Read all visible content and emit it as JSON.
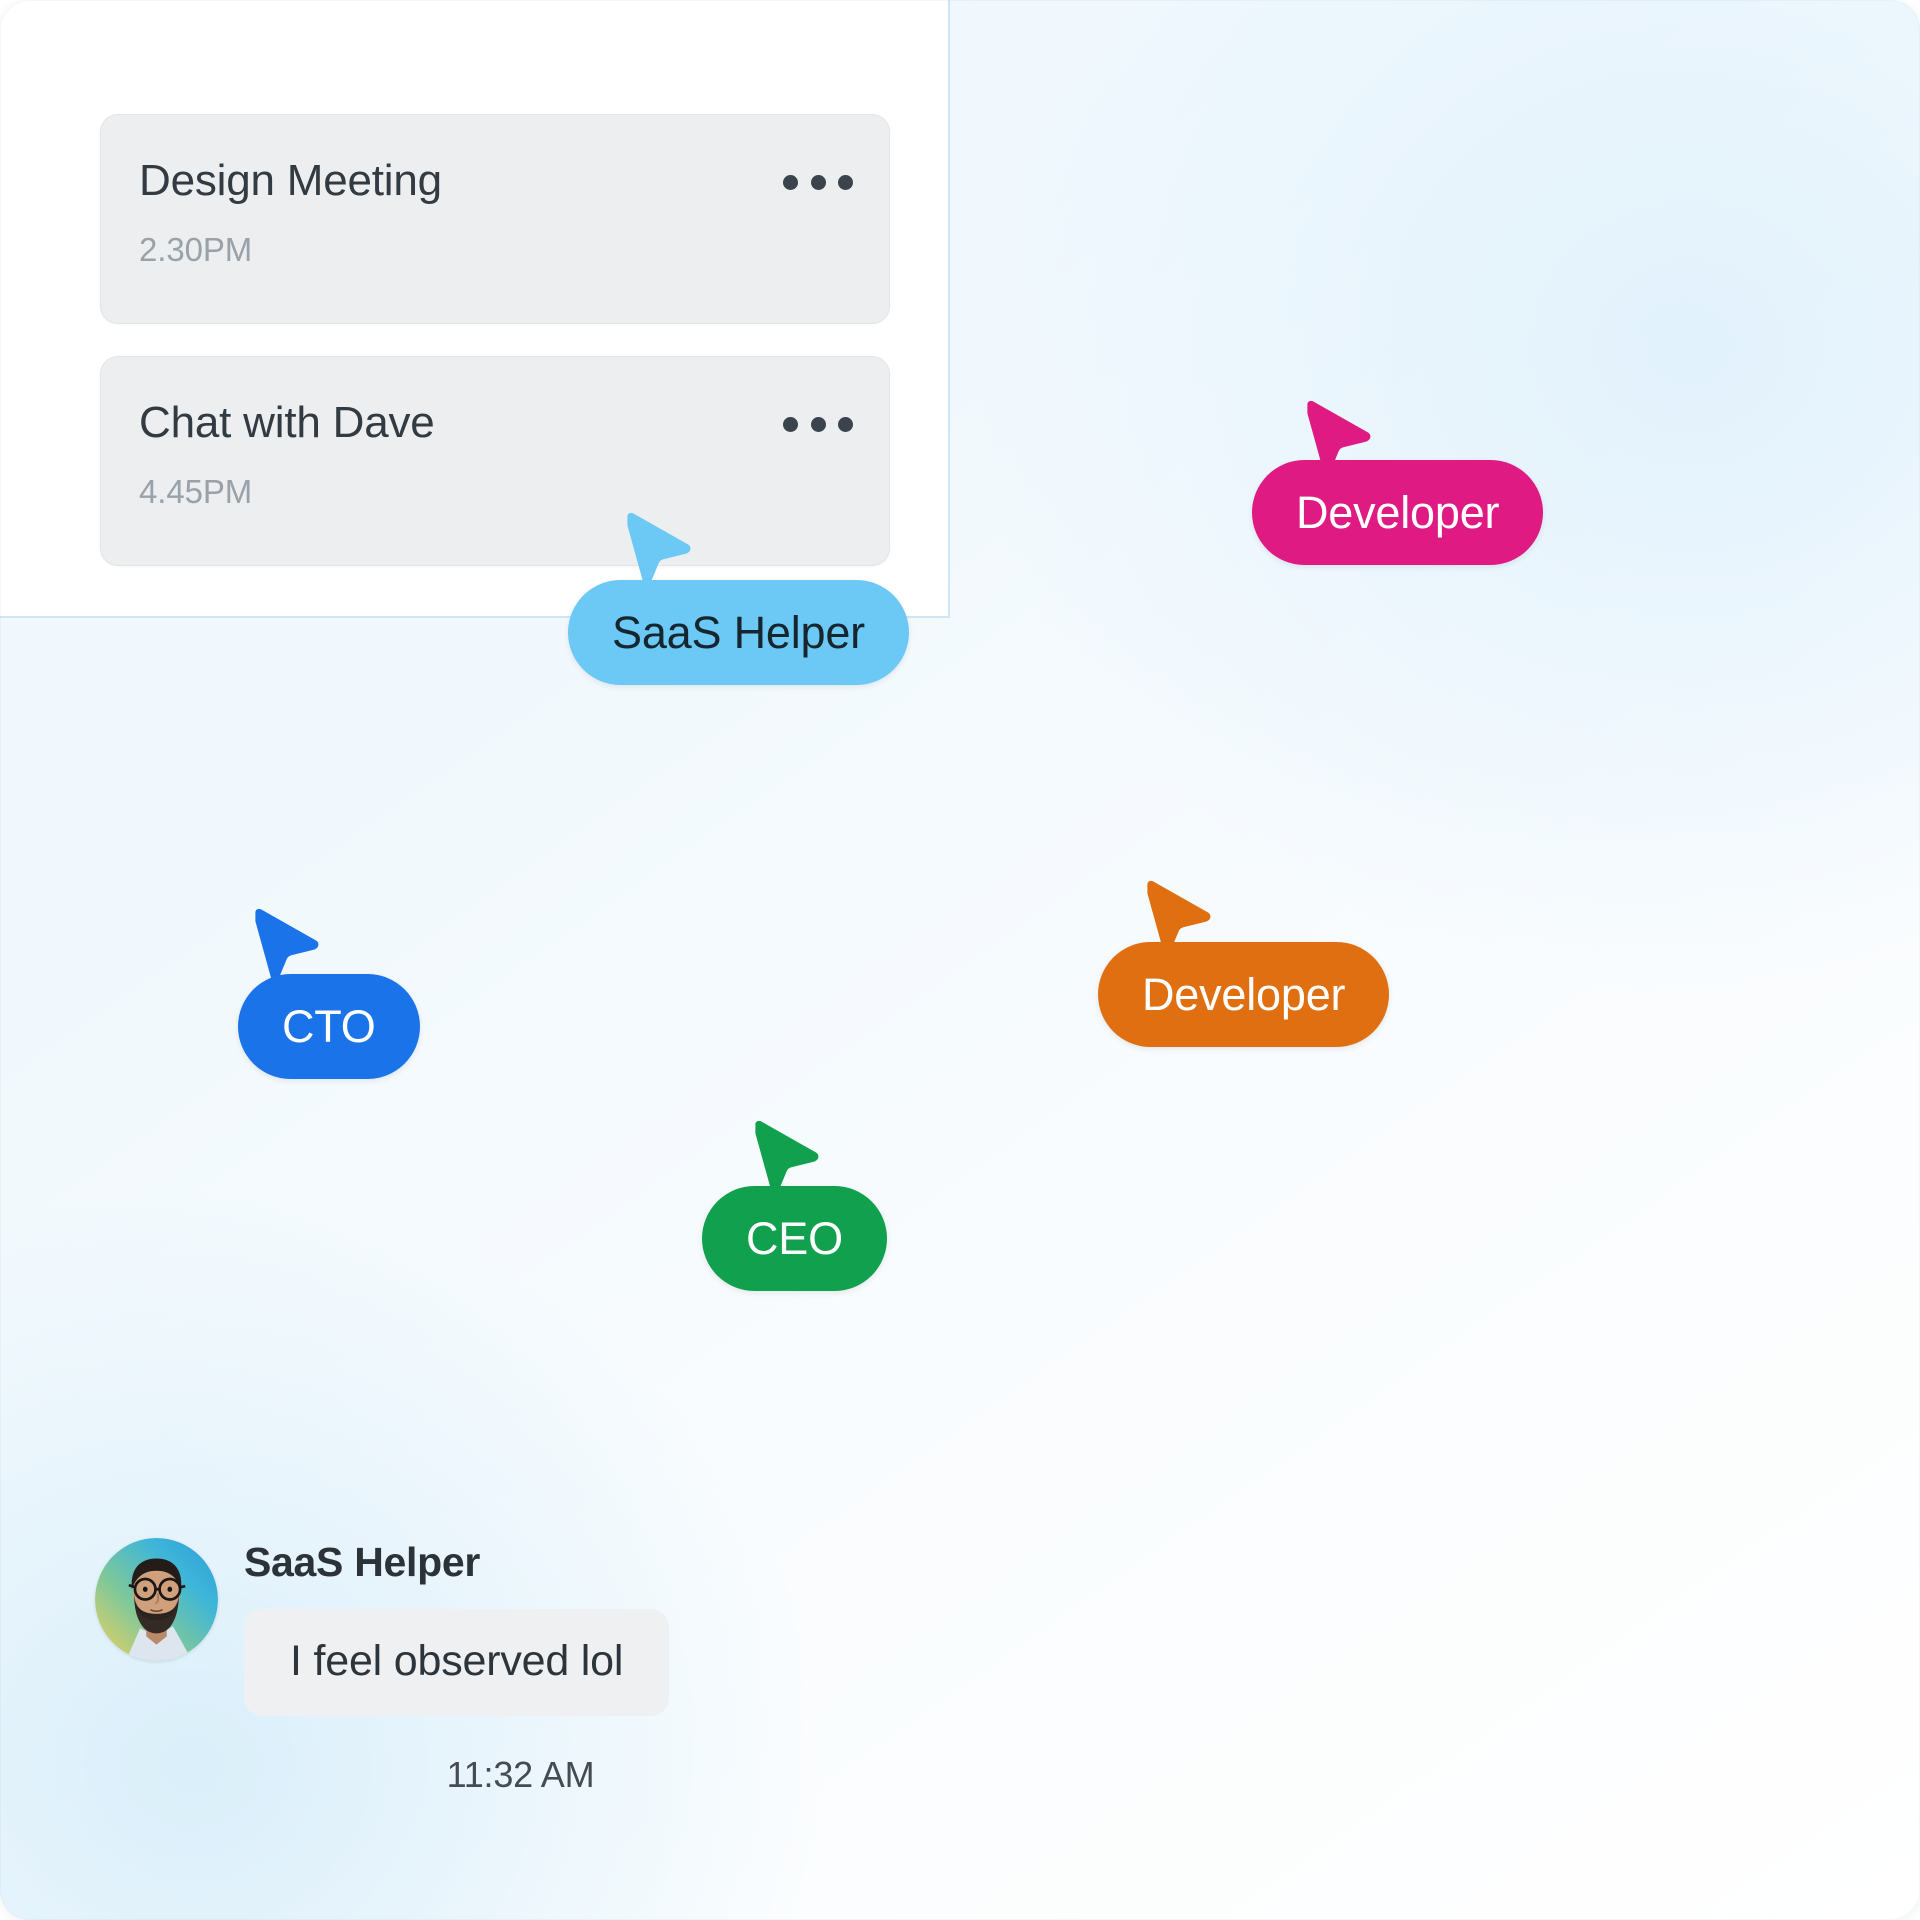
{
  "panel": {
    "name": "conversation-list-panel",
    "cards": [
      {
        "title": "Design Meeting",
        "time": "2.30PM",
        "menu_icon": "ellipsis-horizontal-icon"
      },
      {
        "title": "Chat with Dave",
        "time": "4.45PM",
        "menu_icon": "ellipsis-horizontal-icon"
      }
    ]
  },
  "cursors": [
    {
      "id": "saas-helper",
      "label": "SaaS Helper",
      "color": "#6CC8F5",
      "text_color": "#16262f",
      "icon": "cursor-pointer-icon"
    },
    {
      "id": "developer-pink",
      "label": "Developer",
      "color": "#DF1A83",
      "text_color": "#ffffff",
      "icon": "cursor-pointer-icon"
    },
    {
      "id": "developer-orange",
      "label": "Developer",
      "color": "#DF6F11",
      "text_color": "#ffffff",
      "icon": "cursor-pointer-icon"
    },
    {
      "id": "cto",
      "label": "CTO",
      "color": "#1A73E8",
      "text_color": "#ffffff",
      "icon": "cursor-pointer-icon"
    },
    {
      "id": "ceo",
      "label": "CEO",
      "color": "#11A04D",
      "text_color": "#ffffff",
      "icon": "cursor-pointer-icon"
    }
  ],
  "message": {
    "avatar_alt": "bearded-man-with-glasses-avatar",
    "sender": "SaaS Helper",
    "text": "I feel observed lol",
    "timestamp": "11:32 AM"
  },
  "colors": {
    "card_bg": "#ECEEEF",
    "panel_bg": "#ffffff",
    "divider": "#cfe6f6",
    "bubble_bg": "#EFF0F1",
    "accent_blue": "#1A73E8",
    "accent_pink": "#DF1A83",
    "accent_orange": "#DF6F11",
    "accent_green": "#11A04D",
    "accent_lightblue": "#6CC8F5"
  }
}
